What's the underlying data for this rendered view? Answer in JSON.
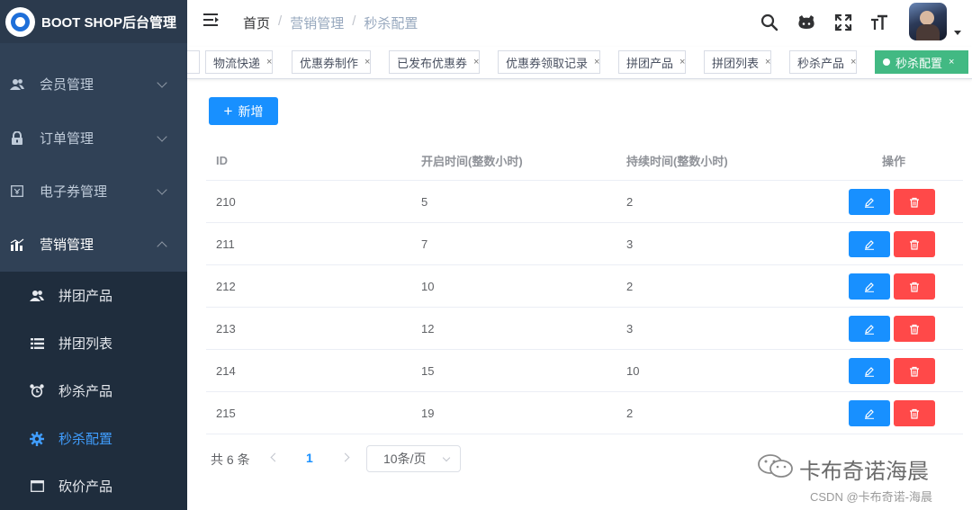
{
  "app": {
    "title": "BOOT SHOP后台管理"
  },
  "sidebar": {
    "menus": [
      {
        "label": "会员管理",
        "icon": "users-icon",
        "expanded": false
      },
      {
        "label": "订单管理",
        "icon": "lock-icon",
        "expanded": false
      },
      {
        "label": "电子券管理",
        "icon": "coupon-icon",
        "expanded": false
      },
      {
        "label": "营销管理",
        "icon": "chart-icon",
        "expanded": true
      }
    ],
    "submenu": [
      {
        "label": "拼团产品",
        "icon": "group-icon",
        "active": false
      },
      {
        "label": "拼团列表",
        "icon": "list-icon",
        "active": false
      },
      {
        "label": "秒杀产品",
        "icon": "alarm-clock-icon",
        "active": false
      },
      {
        "label": "秒杀配置",
        "icon": "gear-icon",
        "active": true
      },
      {
        "label": "砍价产品",
        "icon": "window-icon",
        "active": false
      }
    ],
    "active_color": "#409eff"
  },
  "navbar": {
    "breadcrumb": [
      "首页",
      "营销管理",
      "秒杀配置"
    ],
    "breadcrumb_separator": "/",
    "icons": [
      "search-icon",
      "github-icon",
      "fullscreen-icon",
      "font-size-icon"
    ]
  },
  "tags": [
    {
      "label": "物流快递",
      "active": false
    },
    {
      "label": "优惠券制作",
      "active": false
    },
    {
      "label": "已发布优惠券",
      "active": false
    },
    {
      "label": "优惠券领取记录",
      "active": false
    },
    {
      "label": "拼团产品",
      "active": false
    },
    {
      "label": "拼团列表",
      "active": false
    },
    {
      "label": "秒杀产品",
      "active": false
    },
    {
      "label": "秒杀配置",
      "active": true
    }
  ],
  "tag_close": "×",
  "toolbar": {
    "add_label": "新增",
    "add_icon": "+"
  },
  "table": {
    "headers": [
      "ID",
      "开启时间(整数小时)",
      "持续时间(整数小时)",
      "操作"
    ],
    "rows": [
      {
        "id": "210",
        "start": "5",
        "duration": "2"
      },
      {
        "id": "211",
        "start": "7",
        "duration": "3"
      },
      {
        "id": "212",
        "start": "10",
        "duration": "2"
      },
      {
        "id": "213",
        "start": "12",
        "duration": "3"
      },
      {
        "id": "214",
        "start": "15",
        "duration": "10"
      },
      {
        "id": "215",
        "start": "19",
        "duration": "2"
      }
    ]
  },
  "pagination": {
    "total": "共 6 条",
    "current_page": "1",
    "page_size": "10条/页"
  },
  "watermark": {
    "brand": "卡布奇诺海晨",
    "csdn": "CSDN @卡布奇诺-海晨"
  },
  "colors": {
    "sidebar_bg": "#304156",
    "submenu_bg": "#1f2d3d",
    "primary": "#1890ff",
    "danger": "#ff4949",
    "tag_active": "#42b983"
  }
}
